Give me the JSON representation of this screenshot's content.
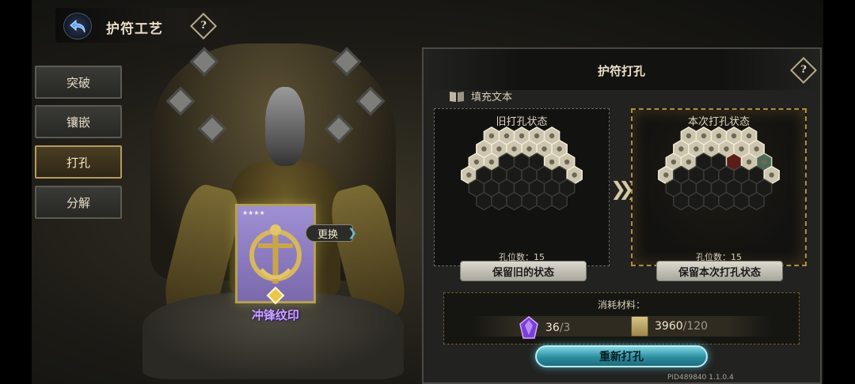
{
  "header": {
    "title": "护符工艺",
    "help_glyph": "?"
  },
  "menu": {
    "items": [
      {
        "label": "突破",
        "active": false
      },
      {
        "label": "镶嵌",
        "active": false
      },
      {
        "label": "打孔",
        "active": true
      },
      {
        "label": "分解",
        "active": false
      }
    ]
  },
  "card": {
    "name": "冲锋纹印",
    "swap_label": "更换",
    "stars": "★★★★",
    "swap_arrow": "❯"
  },
  "panel": {
    "title": "护符打孔",
    "help_glyph": "?",
    "fill_text": "填充文本",
    "old_state": {
      "label": "旧打孔状态",
      "count_label": "孔位数：15",
      "button": "保留旧的状态"
    },
    "new_state": {
      "label": "本次打孔状态",
      "count_label": "孔位数：15",
      "button": "保留本次打孔状态"
    },
    "arrow": "❯❯❯",
    "materials": {
      "title": "消耗材料：",
      "items": [
        {
          "have": "36",
          "need": "/3",
          "icon": "crystal-icon"
        },
        {
          "have": "3960",
          "need": "/120",
          "icon": "scroll-icon"
        }
      ]
    },
    "reset_button": "重新打孔"
  },
  "version": "PID489840  1.1.0.4",
  "colors": {
    "accent_gold": "#b18c3f",
    "reset_cyan": "#2b8ea0",
    "card_purple": "#9f8fd3",
    "card_name": "#c7a8ff"
  }
}
